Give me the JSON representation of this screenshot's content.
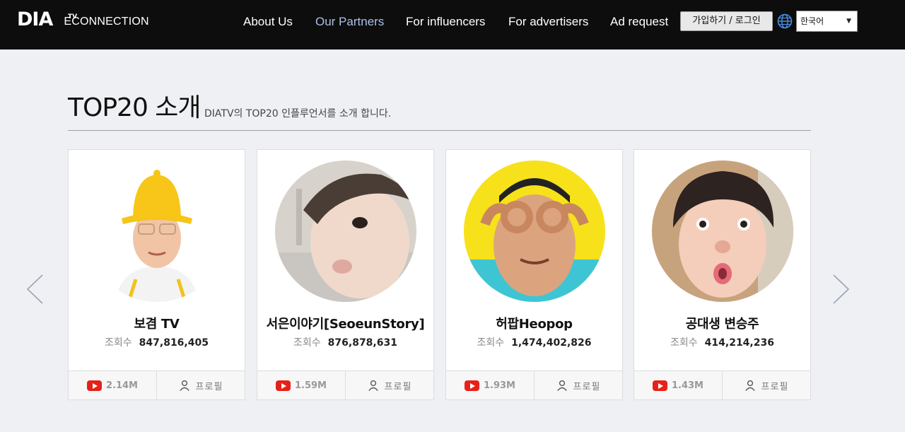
{
  "header": {
    "logo_mark": "DIA",
    "logo_sup": "TV",
    "logo_text": "ECONNECTION",
    "nav": [
      {
        "label": "About Us",
        "active": false
      },
      {
        "label": "Our Partners",
        "active": true
      },
      {
        "label": "For influencers",
        "active": false
      },
      {
        "label": "For advertisers",
        "active": false
      },
      {
        "label": "Ad request",
        "active": false
      }
    ],
    "join_label": "가입하기 / 로그인",
    "language": "한국어",
    "globe_icon": "globe-icon"
  },
  "section": {
    "title": "TOP20 소개",
    "subtitle": "DIATV의 TOP20 인플루언서를 소개 합니다."
  },
  "carousel": {
    "prev_icon": "chevron-left-icon",
    "next_icon": "chevron-right-icon",
    "views_label": "조회수",
    "profile_label": "프로필",
    "cards": [
      {
        "name": "보겸 TV",
        "views": "847,816,405",
        "subscribers": "2.14M"
      },
      {
        "name": "서은이야기[SeoeunStory]",
        "views": "876,878,631",
        "subscribers": "1.59M"
      },
      {
        "name": "허팝Heopop",
        "views": "1,474,402,826",
        "subscribers": "1.93M"
      },
      {
        "name": "공대생 변승주",
        "views": "414,214,236",
        "subscribers": "1.43M"
      }
    ]
  },
  "colors": {
    "header_bg": "#0d0d0d",
    "nav_active": "#a9c2e6",
    "page_bg": "#eef0f4",
    "youtube_red": "#e62117"
  }
}
